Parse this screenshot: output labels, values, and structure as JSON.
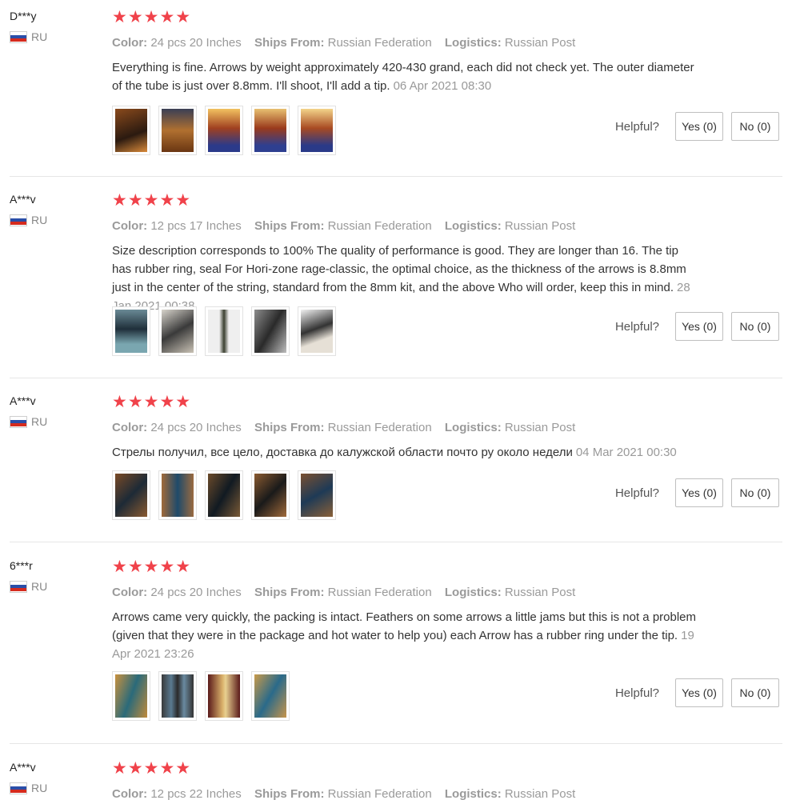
{
  "helpful_label": "Helpful?",
  "labels": {
    "color": "Color:",
    "ships": "Ships From:",
    "logistics": "Logistics:"
  },
  "reviews": [
    {
      "user": "D***y",
      "country": "RU",
      "stars": "★★★★★",
      "color": "24 pcs 20 Inches",
      "ships": "Russian Federation",
      "logistics": "Russian Post",
      "text": "Everything is fine. Arrows by weight approximately 420-430 grand, each did not check yet. The outer diameter of the tube is just over 8.8mm. I'll shoot, I'll add a tip.",
      "date": "06 Apr 2021 08:30",
      "yes": "Yes (0)",
      "no": "No (0)"
    },
    {
      "user": "A***v",
      "country": "RU",
      "stars": "★★★★★",
      "color": "12 pcs 17 Inches",
      "ships": "Russian Federation",
      "logistics": "Russian Post",
      "text": "Size description corresponds to 100% The quality of performance is good. They are longer than 16. The tip has rubber ring, seal For Hori-zone rage-classic, the optimal choice, as the thickness of the arrows is 8.8mm just in the center of the string, standard from the 8mm kit, and the above Who will order, keep this in mind.",
      "date": "28 Jan 2021 00:38",
      "yes": "Yes (0)",
      "no": "No (0)"
    },
    {
      "user": "A***v",
      "country": "RU",
      "stars": "★★★★★",
      "color": "24 pcs 20 Inches",
      "ships": "Russian Federation",
      "logistics": "Russian Post",
      "text": "Стрелы получил, все цело, доставка до калужской области почто ру около недели",
      "date": "04 Mar 2021 00:30",
      "yes": "Yes (0)",
      "no": "No (0)"
    },
    {
      "user": "6***r",
      "country": "RU",
      "stars": "★★★★★",
      "color": "24 pcs 20 Inches",
      "ships": "Russian Federation",
      "logistics": "Russian Post",
      "text": "Arrows came very quickly, the packing is intact. Feathers on some arrows a little jams but this is not a problem (given that they were in the package and hot water to help you) each Arrow has a rubber ring under the tip.",
      "date": "19 Apr 2021 23:26",
      "yes": "Yes (0)",
      "no": "No (0)"
    },
    {
      "user": "A***v",
      "country": "RU",
      "stars": "★★★★★",
      "color": "12 pcs 22 Inches",
      "ships": "Russian Federation",
      "logistics": "Russian Post"
    }
  ]
}
